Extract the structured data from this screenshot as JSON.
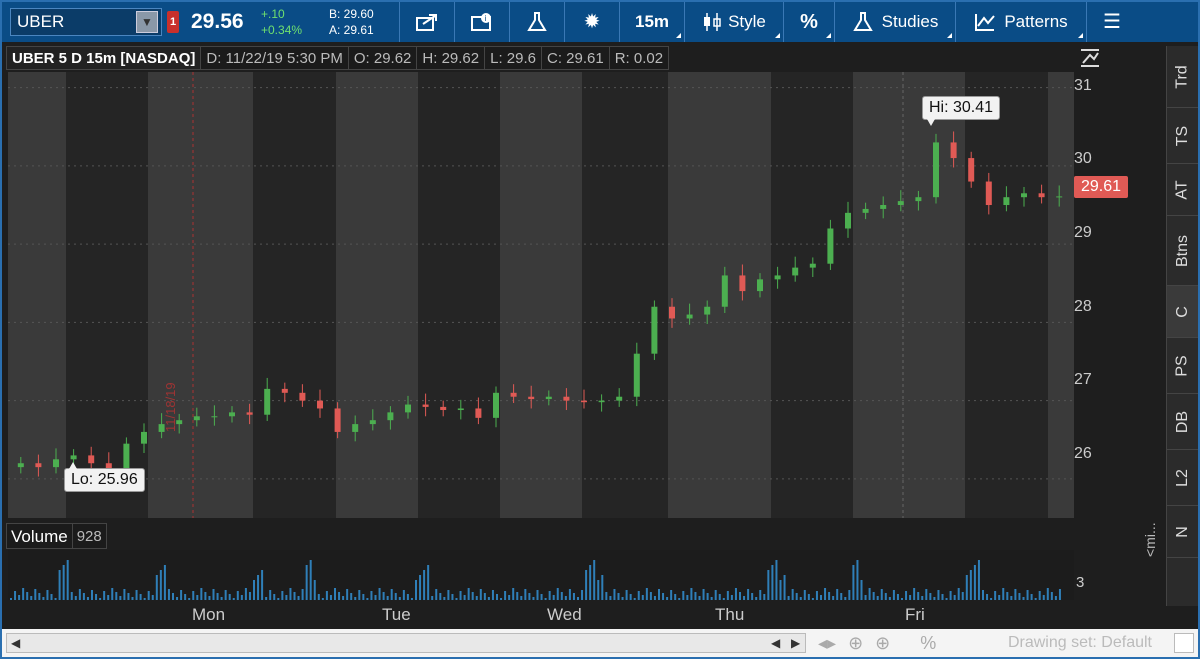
{
  "toolbar": {
    "symbol": "UBER",
    "alert_count": "1",
    "last_price": "29.56",
    "change": "+.10",
    "change_pct": "+0.34%",
    "bid": "B: 29.60",
    "ask": "A: 29.61",
    "timeframe": "15m",
    "style_label": "Style",
    "studies_label": "Studies",
    "patterns_label": "Patterns",
    "icons": [
      "share-icon",
      "quote-icon",
      "flask-icon",
      "gear-icon",
      "candlestick-icon",
      "percent-icon",
      "studies-flask-icon",
      "patterns-icon",
      "menu-icon"
    ]
  },
  "chart_header": {
    "title": "UBER 5 D 15m [NASDAQ]",
    "date": "D: 11/22/19 5:30 PM",
    "open": "O: 29.62",
    "high": "H: 29.62",
    "low": "L: 29.6",
    "close": "C: 29.61",
    "range": "R: 0.02"
  },
  "price_axis": {
    "labels": [
      "31",
      "30",
      "29",
      "28",
      "27",
      "26"
    ],
    "current_price": "29.61"
  },
  "callouts": {
    "high": "Hi: 30.41",
    "low": "Lo: 25.96"
  },
  "date_marker": "11/18/19",
  "volume": {
    "label": "Volume",
    "value": "928",
    "axis_label": "3"
  },
  "x_axis": {
    "labels": [
      "Mon",
      "Tue",
      "Wed",
      "Thu",
      "Fri"
    ]
  },
  "side_tabs": [
    "Trd",
    "TS",
    "AT",
    "Btns",
    "C",
    "PS",
    "DB",
    "L2",
    "N"
  ],
  "collapse_label": "<mi...",
  "bottom_bar": {
    "drawing_set": "Drawing set: Default"
  },
  "colors": {
    "up": "#4caf50",
    "down": "#e05a55",
    "toolbar": "#0a4c86"
  },
  "chart_data": {
    "type": "candlestick",
    "title": "UBER 5 D 15m [NASDAQ]",
    "ylim": [
      25.5,
      31.2
    ],
    "y_ticks": [
      26,
      27,
      28,
      29,
      30,
      31
    ],
    "x_labels": [
      "Mon",
      "Tue",
      "Wed",
      "Thu",
      "Fri"
    ],
    "high": 30.41,
    "low": 25.96,
    "last": 29.61,
    "closes": [
      26.2,
      26.15,
      26.25,
      26.3,
      26.2,
      26.0,
      26.45,
      26.6,
      26.7,
      26.75,
      26.8,
      26.8,
      26.85,
      26.82,
      27.15,
      27.1,
      27.0,
      26.9,
      26.6,
      26.7,
      26.75,
      26.85,
      26.95,
      26.92,
      26.88,
      26.9,
      26.78,
      27.1,
      27.05,
      27.02,
      27.05,
      27.0,
      26.98,
      27.0,
      27.05,
      27.6,
      28.2,
      28.05,
      28.1,
      28.2,
      28.6,
      28.4,
      28.55,
      28.6,
      28.7,
      28.75,
      29.2,
      29.4,
      29.45,
      29.5,
      29.55,
      29.6,
      30.3,
      30.1,
      29.8,
      29.5,
      29.6,
      29.65,
      29.6,
      29.61
    ]
  }
}
